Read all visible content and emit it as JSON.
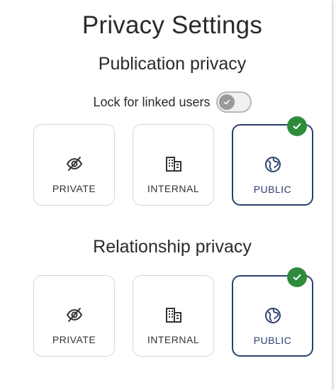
{
  "header": {
    "title": "Privacy Settings"
  },
  "publication": {
    "title": "Publication privacy",
    "lock_label": "Lock for linked users",
    "lock_enabled": false,
    "options": [
      {
        "label": "PRIVATE",
        "icon": "eye-off-icon",
        "selected": false
      },
      {
        "label": "INTERNAL",
        "icon": "building-icon",
        "selected": false
      },
      {
        "label": "PUBLIC",
        "icon": "globe-icon",
        "selected": true
      }
    ]
  },
  "relationship": {
    "title": "Relationship privacy",
    "options": [
      {
        "label": "PRIVATE",
        "icon": "eye-off-icon",
        "selected": false
      },
      {
        "label": "INTERNAL",
        "icon": "building-icon",
        "selected": false
      },
      {
        "label": "PUBLIC",
        "icon": "globe-icon",
        "selected": true
      }
    ]
  },
  "colors": {
    "selected_border": "#2b3f6e",
    "unselected_border": "#cfd8e6",
    "check_badge": "#2e8b3c",
    "toggle_off": "#9a9a9a"
  }
}
